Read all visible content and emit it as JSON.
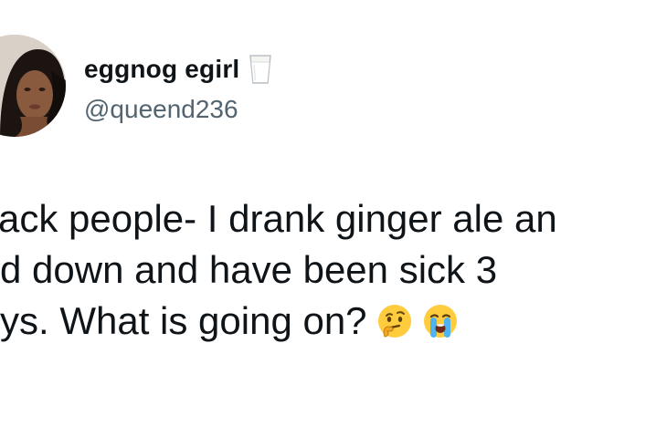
{
  "tweet": {
    "author": {
      "display_name": "eggnog egirl",
      "name_emoji": "glass-of-milk-icon",
      "handle": "@queend236"
    },
    "lines": [
      "ack people- I drank ginger ale an",
      "d down and have been sick 3",
      "ys. What is going on?"
    ],
    "emojis": [
      "thinking-face-icon",
      "loudly-crying-face-icon"
    ]
  },
  "colors": {
    "text": "#0f1419",
    "handle": "#536471",
    "background": "#ffffff"
  }
}
